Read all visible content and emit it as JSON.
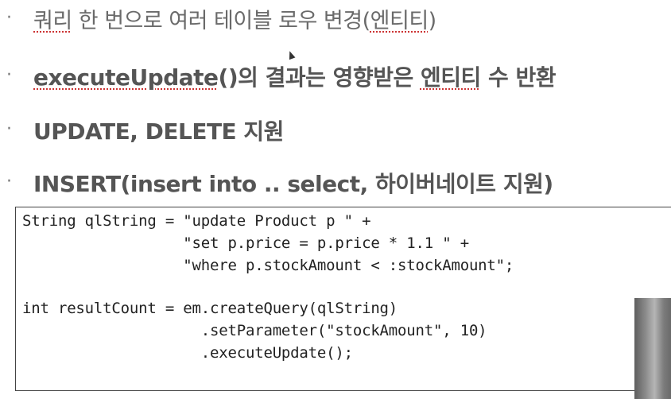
{
  "bullets": {
    "b1": {
      "part1": "쿼리",
      "part2": " 한 번으로 여러 테이블 로우 변경(",
      "part3": "엔티티",
      "part4": ")"
    },
    "b2": {
      "part1": "executeUpdate",
      "part2": "()의 결과는 영향받은 ",
      "part3": "엔티티",
      "part4": " 수 반환"
    },
    "b3": {
      "text": "UPDATE, DELETE 지원"
    },
    "b4": {
      "text": "INSERT(insert into .. select, 하이버네이트 지원)"
    },
    "bullet_glyph": "·"
  },
  "code": {
    "line1": "String qlString = \"update Product p \" +",
    "line2": "                  \"set p.price = p.price * 1.1 \" +",
    "line3": "                  \"where p.stockAmount < :stockAmount\";",
    "line4": "int resultCount = em.createQuery(qlString)",
    "line5": "                    .setParameter(\"stockAmount\", 10)",
    "line6": "                    .executeUpdate();"
  }
}
